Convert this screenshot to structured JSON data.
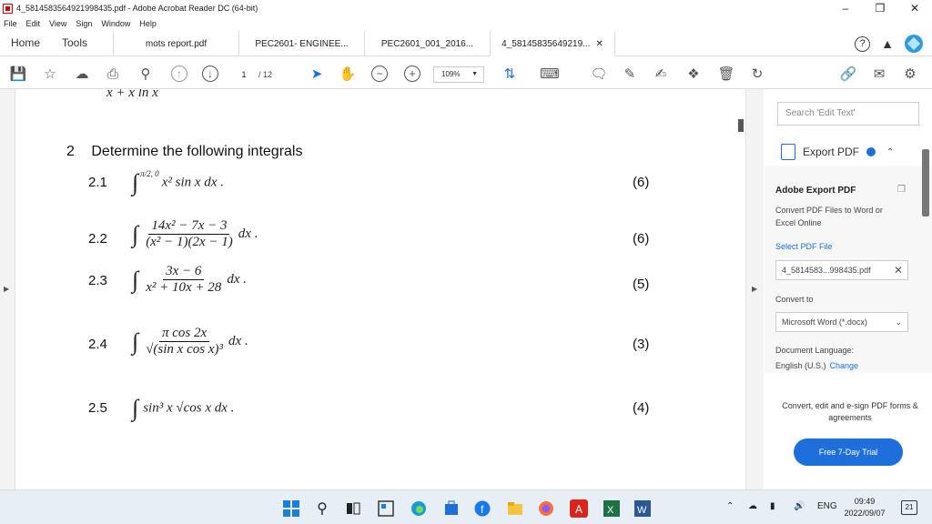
{
  "window": {
    "title": "4_5814583564921998435.pdf - Adobe Acrobat Reader DC (64-bit)",
    "minimize": "–",
    "restore": "❐",
    "close": "✕"
  },
  "menu": [
    "File",
    "Edit",
    "View",
    "Sign",
    "Window",
    "Help"
  ],
  "tabs": {
    "home": "Home",
    "tools": "Tools",
    "docs": [
      "mots report.pdf",
      "PEC2601- ENGINEE...",
      "PEC2601_001_2016...",
      "4_58145835649219..."
    ]
  },
  "toolbar": {
    "page_current": "1",
    "page_total": "/ 12",
    "zoom": "109%"
  },
  "document": {
    "fragment": "x + x ln x",
    "question": {
      "number": "2",
      "text": "Determine the following integrals"
    },
    "items": [
      {
        "num": "2.1",
        "marks": "(6)"
      },
      {
        "num": "2.2",
        "marks": "(6)"
      },
      {
        "num": "2.3",
        "marks": "(5)"
      },
      {
        "num": "2.4",
        "marks": "(3)"
      },
      {
        "num": "2.5",
        "marks": "(4)"
      }
    ],
    "exprs": {
      "e1": "x² sin x dx .",
      "e2_num": "14x² − 7x − 3",
      "e2_den": "(x² − 1)(2x − 1)",
      "e2_tail": "dx .",
      "e3_num": "3x − 6",
      "e3_den": "x² + 10x + 28",
      "e3_tail": "dx .",
      "e4_num": "π cos 2x",
      "e4_den": "√(sin x cos x)³",
      "e4_tail": "dx .",
      "e5": "sin³ x √cos x  dx ."
    }
  },
  "panel": {
    "search_placeholder": "Search 'Edit Text'",
    "export_label": "Export PDF",
    "section_title": "Adobe Export PDF",
    "section_desc": "Convert PDF Files to Word or Excel Online",
    "select_file": "Select PDF File",
    "file_name": "4_5814583...998435.pdf",
    "convert_to": "Convert to",
    "format": "Microsoft Word (*.docx)",
    "lang_label": "Document Language:",
    "lang_value": "English (U.S.)",
    "lang_change": "Change",
    "promo": "Convert, edit and e-sign PDF forms & agreements",
    "trial_button": "Free 7-Day Trial"
  },
  "taskbar": {
    "lang": "ENG",
    "time": "09:49",
    "date": "2022/09/07",
    "notifications": "21"
  }
}
